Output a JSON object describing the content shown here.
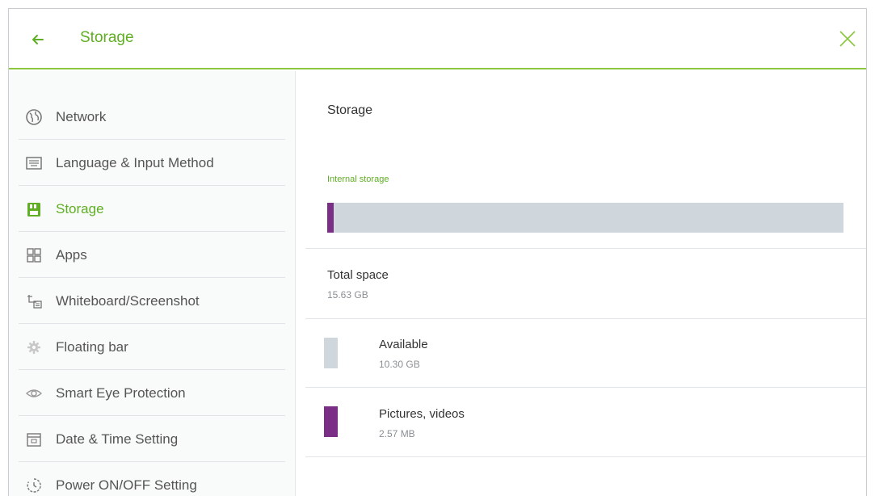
{
  "header": {
    "title": "Storage",
    "accent_color": "#5fae23"
  },
  "sidebar": {
    "items": [
      {
        "label": "Network",
        "icon": "globe-icon",
        "active": false
      },
      {
        "label": "Language & Input Method",
        "icon": "keyboard-icon",
        "active": false
      },
      {
        "label": "Storage",
        "icon": "sd-card-icon",
        "active": true
      },
      {
        "label": "Apps",
        "icon": "apps-grid-icon",
        "active": false
      },
      {
        "label": "Whiteboard/Screenshot",
        "icon": "whiteboard-icon",
        "active": false
      },
      {
        "label": "Floating bar",
        "icon": "gear-icon",
        "active": false
      },
      {
        "label": "Smart Eye Protection",
        "icon": "eye-icon",
        "active": false
      },
      {
        "label": "Date & Time Setting",
        "icon": "calendar-icon",
        "active": false
      },
      {
        "label": "Power ON/OFF Setting",
        "icon": "power-timer-icon",
        "active": false
      }
    ]
  },
  "content": {
    "title": "Storage",
    "internal_storage_label": "Internal storage",
    "storage_bar": {
      "used_fraction": 0.012,
      "used_color": "#7a2e86",
      "free_color": "#cfd6dc"
    },
    "total_space": {
      "label": "Total space",
      "value": "15.63 GB"
    },
    "available": {
      "label": "Available",
      "value": "10.30 GB",
      "color": "#cfd6dc"
    },
    "pictures_videos": {
      "label": "Pictures, videos",
      "value": "2.57 MB",
      "color": "#7a2e86"
    }
  }
}
